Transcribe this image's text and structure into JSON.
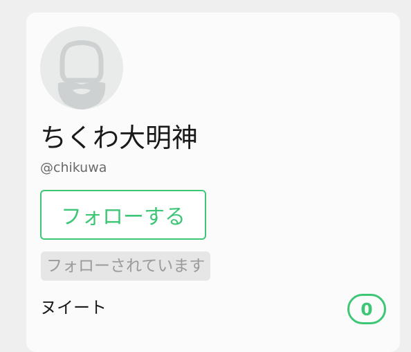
{
  "profile": {
    "avatar_icon": "default-user-avatar-icon",
    "display_name": "ちくわ大明神",
    "username": "@chikuwa",
    "follow_button_label": "フォローする",
    "follows_you_badge": "フォローされています",
    "tweets_label": "ヌイート",
    "tweets_count": "0"
  },
  "colors": {
    "accent": "#3cc676",
    "background": "#efefef",
    "card": "#fbfbfb",
    "badge_bg": "#e6e6e6"
  }
}
